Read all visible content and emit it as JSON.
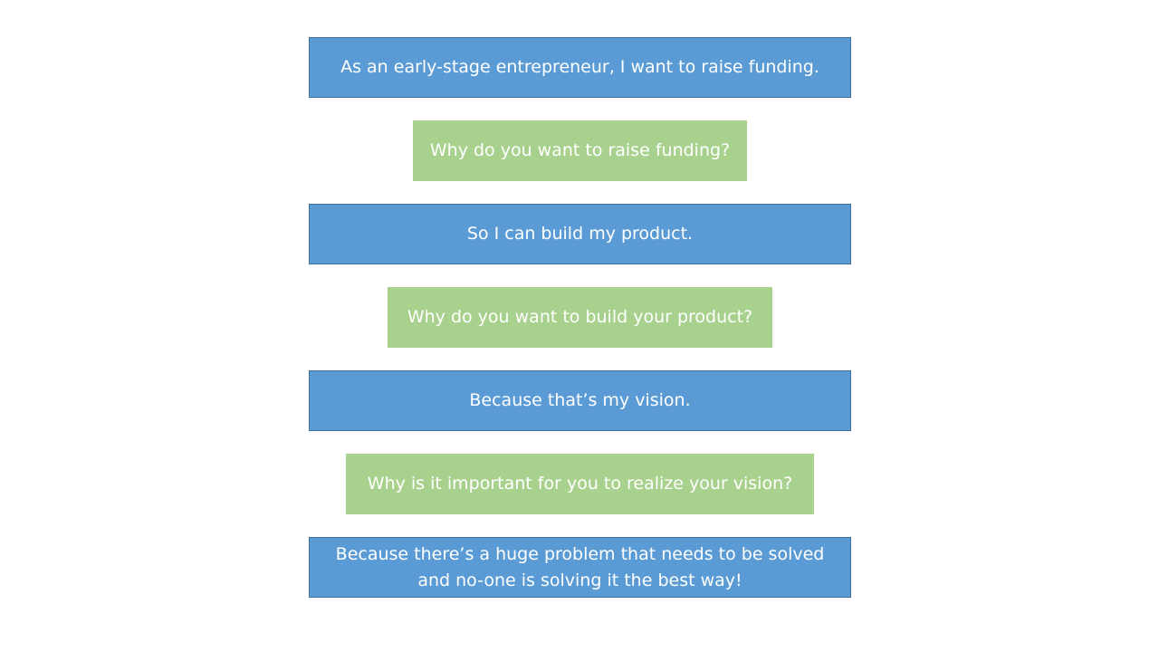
{
  "boxes": [
    {
      "kind": "statement",
      "text": "As an early-stage entrepreneur, I want to raise funding."
    },
    {
      "kind": "question",
      "text": "Why do you want to raise funding?"
    },
    {
      "kind": "statement",
      "text": "So I can build my product."
    },
    {
      "kind": "question",
      "text": "Why do you want to build your product?"
    },
    {
      "kind": "statement",
      "text": "Because that’s my vision."
    },
    {
      "kind": "question",
      "text": "Why is it important for you to realize your vision?"
    },
    {
      "kind": "statement",
      "text": "Because there’s a huge problem that needs to be solved\nand no-one is solving it the best way!"
    }
  ],
  "colors": {
    "statement_fill": "#5b9bd5",
    "statement_border": "#41719c",
    "question_fill": "#a9d18e",
    "text": "#ffffff",
    "background": "#ffffff"
  }
}
